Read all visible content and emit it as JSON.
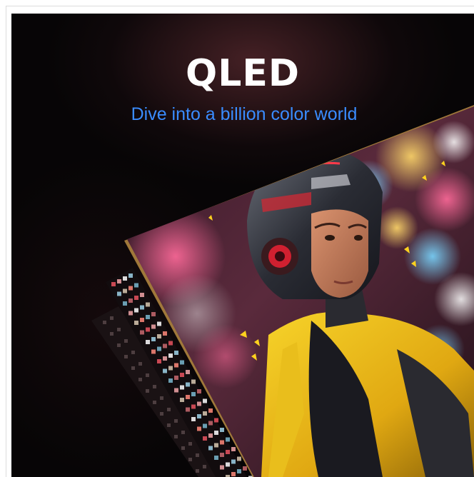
{
  "banner": {
    "title": "QLED",
    "subtitle": "Dive into a billion color world",
    "colors": {
      "title": "#ffffff",
      "subtitle": "#3a8cff",
      "background": "#070506",
      "suit_accent": "#f0c418"
    },
    "image_description": "Tilted display panel with exploded pixel layers showing a rider in a helmet and yellow suit against a neon bokeh background"
  }
}
